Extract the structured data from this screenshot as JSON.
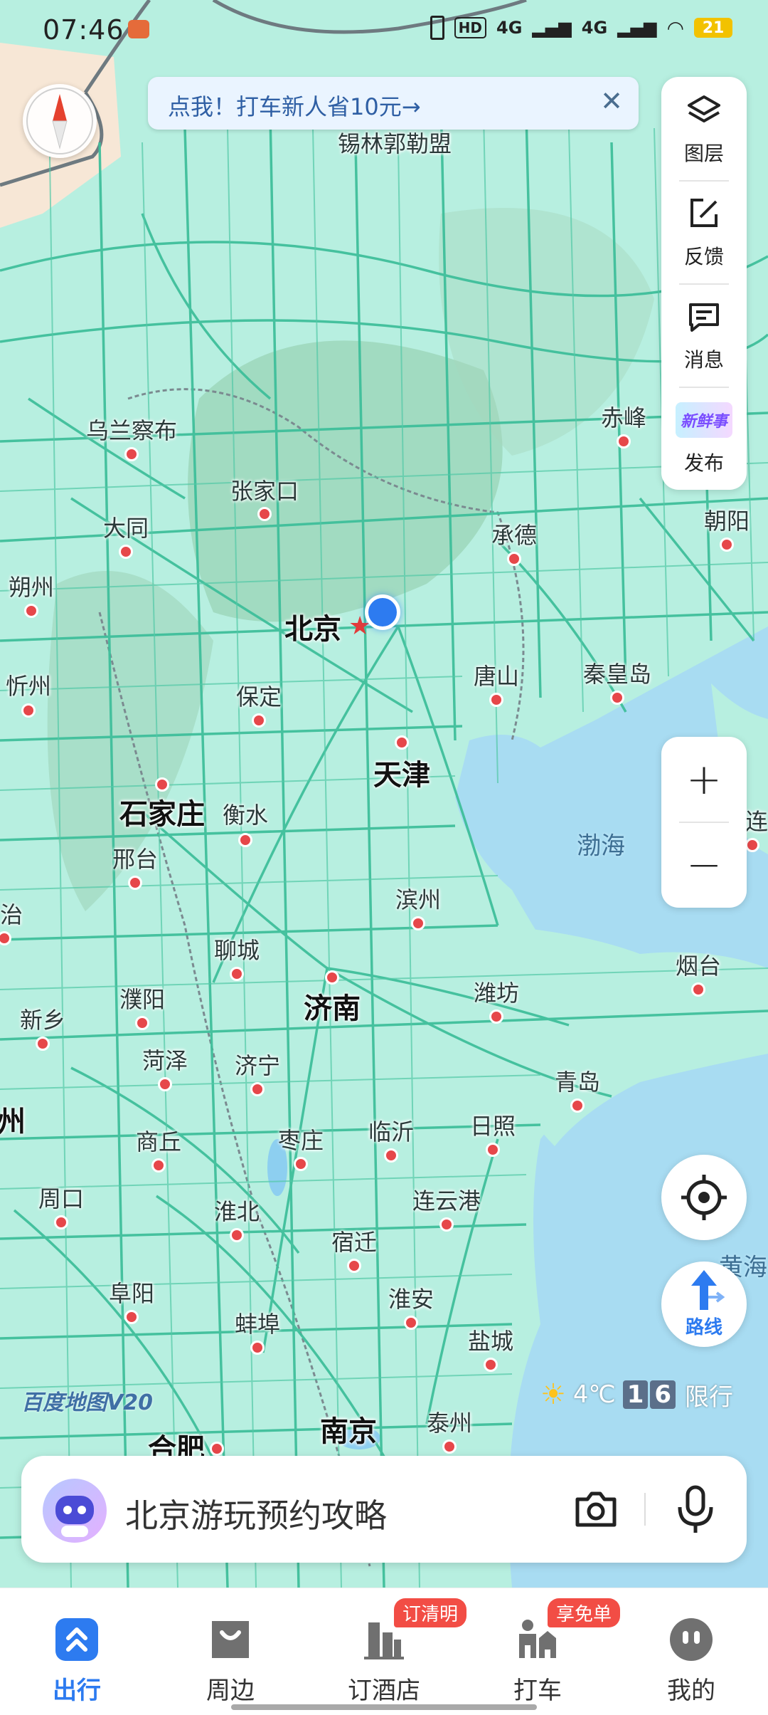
{
  "status_bar": {
    "time": "07:46",
    "hd": "HD",
    "net1": "4G",
    "net2": "4G",
    "battery": "21"
  },
  "promo": {
    "text": "点我！打车新人省10元→",
    "close": "✕"
  },
  "side_panel": {
    "items": [
      {
        "label": "图层",
        "icon": "layers-icon"
      },
      {
        "label": "反馈",
        "icon": "feedback-edit-icon"
      },
      {
        "label": "消息",
        "icon": "message-icon"
      },
      {
        "label": "发布",
        "icon": "new-post-icon"
      }
    ],
    "publish_badge": "新鲜事"
  },
  "map": {
    "cities": [
      {
        "id": "xilinguole",
        "name": "锡林郭勒盟",
        "dot": false
      },
      {
        "id": "ulanqab",
        "name": "乌兰察布",
        "dot": true
      },
      {
        "id": "zhangjiakou",
        "name": "张家口",
        "dot": true
      },
      {
        "id": "chifeng",
        "name": "赤峰",
        "dot": true
      },
      {
        "id": "datong",
        "name": "大同",
        "dot": true
      },
      {
        "id": "chengde",
        "name": "承德",
        "dot": true
      },
      {
        "id": "chaoyang",
        "name": "朝阳",
        "dot": true
      },
      {
        "id": "shuozhou",
        "name": "朔州",
        "dot": true
      },
      {
        "id": "beijing",
        "name": "北京",
        "dot": false,
        "big": true
      },
      {
        "id": "xinzhou",
        "name": "忻州",
        "dot": true
      },
      {
        "id": "baoding",
        "name": "保定",
        "dot": true
      },
      {
        "id": "tangshan",
        "name": "唐山",
        "dot": true
      },
      {
        "id": "qinhuangdao",
        "name": "秦皇岛",
        "dot": true
      },
      {
        "id": "tianjin",
        "name": "天津",
        "dot": true,
        "big": true
      },
      {
        "id": "shijiazhuang",
        "name": "石家庄",
        "dot": true,
        "big": true
      },
      {
        "id": "hengshui",
        "name": "衡水",
        "dot": true
      },
      {
        "id": "bohai",
        "name": "渤海",
        "dot": false,
        "sea": true
      },
      {
        "id": "xingtai",
        "name": "邢台",
        "dot": true
      },
      {
        "id": "binzhou",
        "name": "滨州",
        "dot": true
      },
      {
        "id": "yantai",
        "name": "烟台",
        "dot": true
      },
      {
        "id": "liaocheng",
        "name": "聊城",
        "dot": true
      },
      {
        "id": "jinan",
        "name": "济南",
        "dot": true,
        "big": true
      },
      {
        "id": "weifang",
        "name": "潍坊",
        "dot": true
      },
      {
        "id": "puyang",
        "name": "濮阳",
        "dot": true
      },
      {
        "id": "xinxiang",
        "name": "新乡",
        "dot": true
      },
      {
        "id": "heze",
        "name": "菏泽",
        "dot": true
      },
      {
        "id": "jining",
        "name": "济宁",
        "dot": true
      },
      {
        "id": "qingdao",
        "name": "青岛",
        "dot": true
      },
      {
        "id": "shangqiu",
        "name": "商丘",
        "dot": true
      },
      {
        "id": "zaozhuang",
        "name": "枣庄",
        "dot": true
      },
      {
        "id": "linyi",
        "name": "临沂",
        "dot": true
      },
      {
        "id": "rizhao",
        "name": "日照",
        "dot": true
      },
      {
        "id": "zhoukou",
        "name": "周口",
        "dot": true
      },
      {
        "id": "huaibei",
        "name": "淮北",
        "dot": true
      },
      {
        "id": "lianyungang",
        "name": "连云港",
        "dot": true
      },
      {
        "id": "suqian",
        "name": "宿迁",
        "dot": true
      },
      {
        "id": "huanghai",
        "name": "黄海",
        "dot": false,
        "sea": true
      },
      {
        "id": "fuyang",
        "name": "阜阳",
        "dot": true
      },
      {
        "id": "huaian",
        "name": "淮安",
        "dot": true
      },
      {
        "id": "bengbu",
        "name": "蚌埠",
        "dot": true
      },
      {
        "id": "yancheng",
        "name": "盐城",
        "dot": true
      },
      {
        "id": "nanjing",
        "name": "南京",
        "dot": false,
        "big": true
      },
      {
        "id": "taizhou",
        "name": "泰州",
        "dot": true
      },
      {
        "id": "hefei",
        "name": "合肥",
        "dot": true,
        "big": true
      },
      {
        "id": "edge_zhi",
        "name": "治",
        "dot": true
      },
      {
        "id": "edge_zhou",
        "name": "州",
        "dot": false,
        "big": true
      },
      {
        "id": "edge_lian",
        "name": "连",
        "dot": true
      }
    ],
    "brand": "百度地图V20"
  },
  "weather": {
    "temp": "4℃",
    "limit_a": "1",
    "limit_b": "6",
    "limit_label": "限行"
  },
  "route_label": "路线",
  "zoom": {
    "in": "+",
    "out": "−"
  },
  "search": {
    "text": "北京游玩预约攻略"
  },
  "nav": {
    "items": [
      {
        "label": "出行",
        "active": true
      },
      {
        "label": "周边"
      },
      {
        "label": "订酒店",
        "badge": "订清明"
      },
      {
        "label": "打车",
        "badge": "享免单"
      },
      {
        "label": "我的"
      }
    ]
  },
  "colors": {
    "accent": "#2d7bf0",
    "map_land": "#b7efe0",
    "map_sea": "#a8dcf2",
    "road": "#3fbf9b",
    "badge": "#f24d45"
  }
}
